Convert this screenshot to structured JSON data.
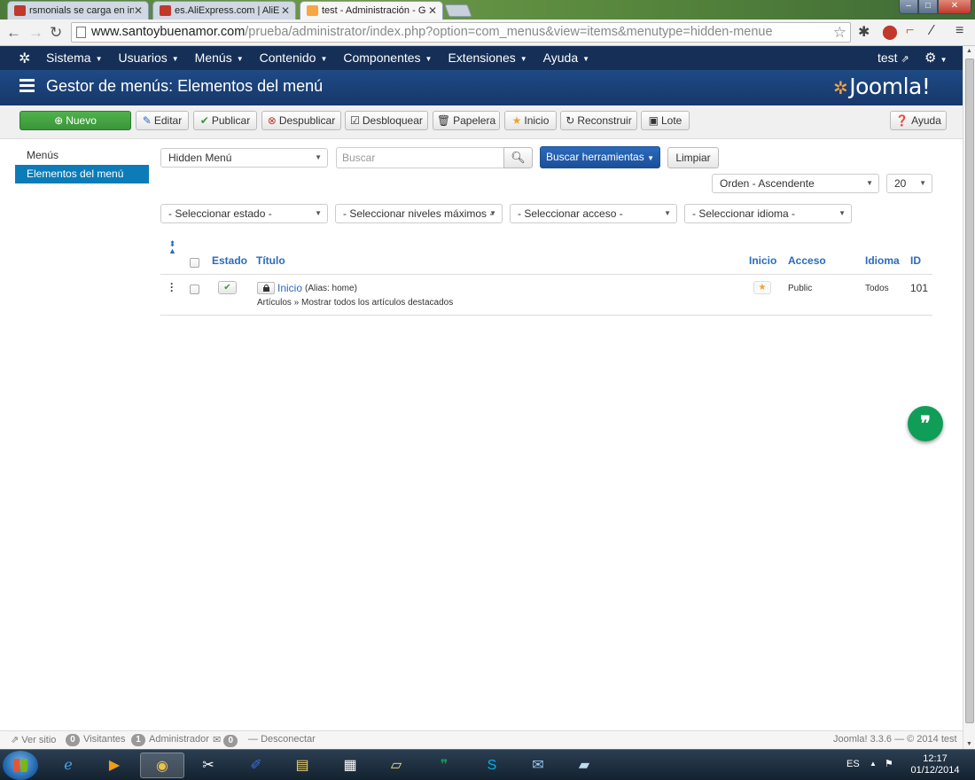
{
  "browser": {
    "tabs": [
      {
        "title": "rsmonials se carga en inic",
        "favicon_color": "#c0392b"
      },
      {
        "title": "es.AliExpress.com | AliExp",
        "favicon_color": "#c0392b"
      },
      {
        "title": "test - Administración - Ge",
        "favicon_color": "#f9a541"
      }
    ],
    "url_domain": "www.santoybuenamor.com",
    "url_path": "/prueba/administrator/index.php?option=com_menus&view=items&menutype=hidden-menue"
  },
  "navbar": {
    "menus": [
      "Sistema",
      "Usuarios",
      "Menús",
      "Contenido",
      "Componentes",
      "Extensiones",
      "Ayuda"
    ],
    "user": "test"
  },
  "header": {
    "title": "Gestor de menús: Elementos del menú",
    "brand": "Joomla!"
  },
  "toolbar": {
    "new": "Nuevo",
    "edit": "Editar",
    "publish": "Publicar",
    "unpublish": "Despublicar",
    "checkin": "Desbloquear",
    "trash": "Papelera",
    "home": "Inicio",
    "rebuild": "Reconstruir",
    "batch": "Lote",
    "help": "Ayuda"
  },
  "sidebar": {
    "items": [
      {
        "label": "Menús"
      },
      {
        "label": "Elementos del menú"
      }
    ]
  },
  "filters": {
    "menu_select": "Hidden Menú",
    "search_placeholder": "Buscar",
    "search_tools": "Buscar herramientas",
    "clear": "Limpiar",
    "order": "Orden - Ascendente",
    "limit": "20",
    "state": "- Seleccionar estado -",
    "levels": "- Seleccionar niveles máximos -",
    "access": "- Seleccionar acceso -",
    "language": "- Seleccionar idioma -"
  },
  "table": {
    "headers": {
      "status": "Estado",
      "title": "Título",
      "home": "Inicio",
      "access": "Acceso",
      "language": "Idioma",
      "id": "ID"
    },
    "rows": [
      {
        "title": "Inicio",
        "alias": "(Alias: home)",
        "type": "Artículos » Mostrar todos los artículos destacados",
        "access": "Public",
        "language": "Todos",
        "id": "101"
      }
    ]
  },
  "footer": {
    "view_site": "Ver sitio",
    "visitors_count": "0",
    "visitors": "Visitantes",
    "admins_count": "1",
    "admins": "Administrador",
    "messages_count": "0",
    "logout": "Desconectar",
    "version": "Joomla! 3.3.6 — © 2014 test"
  },
  "taskbar": {
    "language": "ES",
    "time": "12:17",
    "date": "01/12/2014"
  },
  "colors": {
    "nav_bg": "#152f57",
    "header_bg": "#1e4a85",
    "accent": "#0b7cb7",
    "primary_button": "#2a6bbd",
    "new_button": "#3b953a",
    "fab": "#0f9d58"
  }
}
